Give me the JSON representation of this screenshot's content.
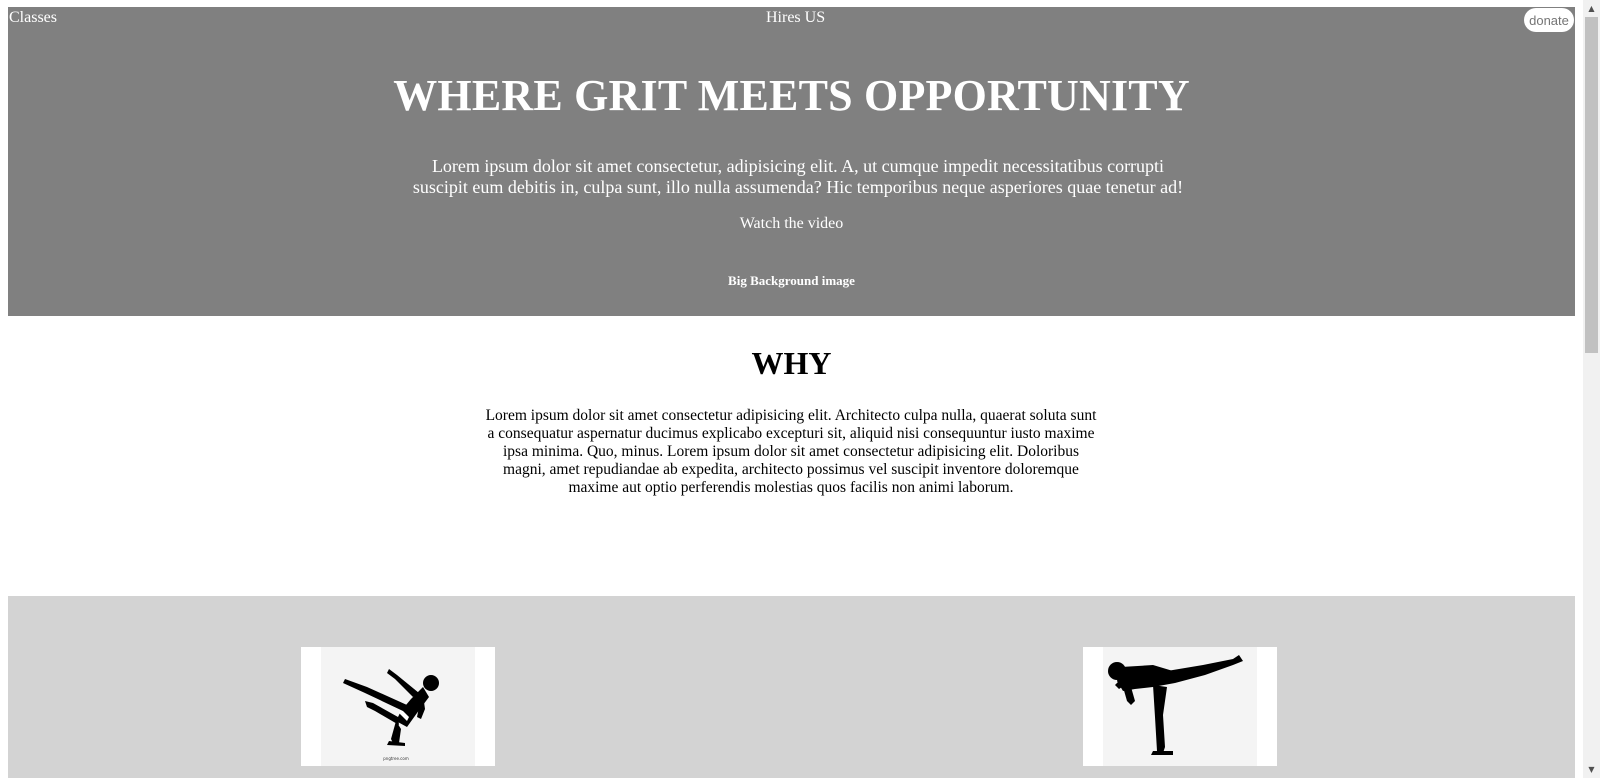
{
  "nav": {
    "classes_label": "Classes",
    "hires_label": "Hires US",
    "donate_label": "donate"
  },
  "hero": {
    "title": "WHERE GRIT MEETS OPPORTUNITY",
    "text": "Lorem ipsum dolor sit amet consectetur, adipisicing elit. A, ut cumque impedit necessitatibus corrupti suscipit eum debitis in, culpa sunt, illo nulla assumenda? Hic temporibus neque asperiores quae tenetur ad!",
    "video_link": "Watch the video",
    "caption": "Big Background image",
    "background_color": "#808080"
  },
  "why": {
    "title": "WHY",
    "text": "Lorem ipsum dolor sit amet consectetur adipisicing elit. Architecto culpa nulla, quaerat soluta sunt a consequatur aspernatur ducimus explicabo excepturi sit, aliquid nisi consequuntur iusto maxime ipsa minima. Quo, minus. Lorem ipsum dolor sit amet consectetur adipisicing elit. Doloribus magni, amet repudiandae ab expedita, architecto possimus vel suscipit inventore doloremque maxime aut optio perferendis molestias quos facilis non animi laborum."
  },
  "gallery": {
    "background_color": "#d3d3d3",
    "images": [
      {
        "name": "karate-kick-image-1",
        "watermark": "pngtree.com"
      },
      {
        "name": "karate-kick-image-2"
      }
    ]
  },
  "scrollbar": {
    "up_icon": "▲",
    "down_icon": "▼"
  }
}
